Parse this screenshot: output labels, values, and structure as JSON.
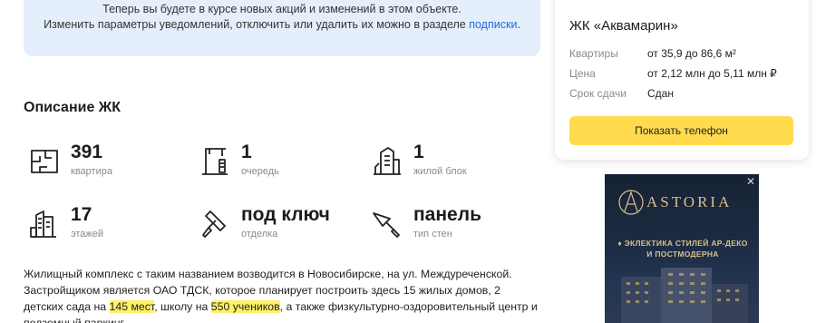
{
  "notice": {
    "line1": "Теперь вы будете в курсе новых акций и изменений в этом объекте.",
    "line2_prefix": "Изменить параметры уведомлений, отключить или удалить их можно в разделе ",
    "line2_link": "подписки",
    "line2_suffix": "."
  },
  "section_title": "Описание ЖК",
  "stats": [
    {
      "icon": "apartment-plan-icon",
      "value": "391",
      "label": "квартира"
    },
    {
      "icon": "crane-icon",
      "value": "1",
      "label": "очередь"
    },
    {
      "icon": "buildings-icon",
      "value": "1",
      "label": "жилой блок"
    },
    {
      "icon": "tall-building-icon",
      "value": "17",
      "label": "этажей"
    },
    {
      "icon": "paint-roller-icon",
      "value": "под ключ",
      "label": "отделка"
    },
    {
      "icon": "trowel-icon",
      "value": "панель",
      "label": "тип стен"
    }
  ],
  "description": {
    "part1": "Жилищный комплекс с таким названием возводится в Новосибирске, на ул. Междуреченской. Застройщиком является ОАО ТДСК, которое планирует построить здесь 15 жилых домов, 2 детских сада на ",
    "hl1": "145 мест",
    "part2": ", школу на ",
    "hl2": "550 учеников",
    "part3": ", а также физкультурно-оздоровительный центр и подземный паркинг."
  },
  "card": {
    "title": "ЖК «Аквамарин»",
    "rows": [
      {
        "key": "Квартиры",
        "value": "от 35,9 до 86,6 м²"
      },
      {
        "key": "Цена",
        "value": "от 2,12 млн до 5,11 млн ₽"
      },
      {
        "key": "Срок сдачи",
        "value": "Сдан"
      }
    ],
    "button_label": "Показать телефон"
  },
  "ad": {
    "close": "✕",
    "brand": "ASTORIA",
    "tagline_line1": "♦ ЭКЛЕКТИКА СТИЛЕЙ АР-ДЕКО",
    "tagline_line2": "И ПОСТМОДЕРНА"
  },
  "colors": {
    "notice_bg": "#e5effb",
    "link": "#1a6ce0",
    "button": "#ffdb4d",
    "highlight": "#fff06a",
    "ad_gold": "#d8c08a"
  }
}
